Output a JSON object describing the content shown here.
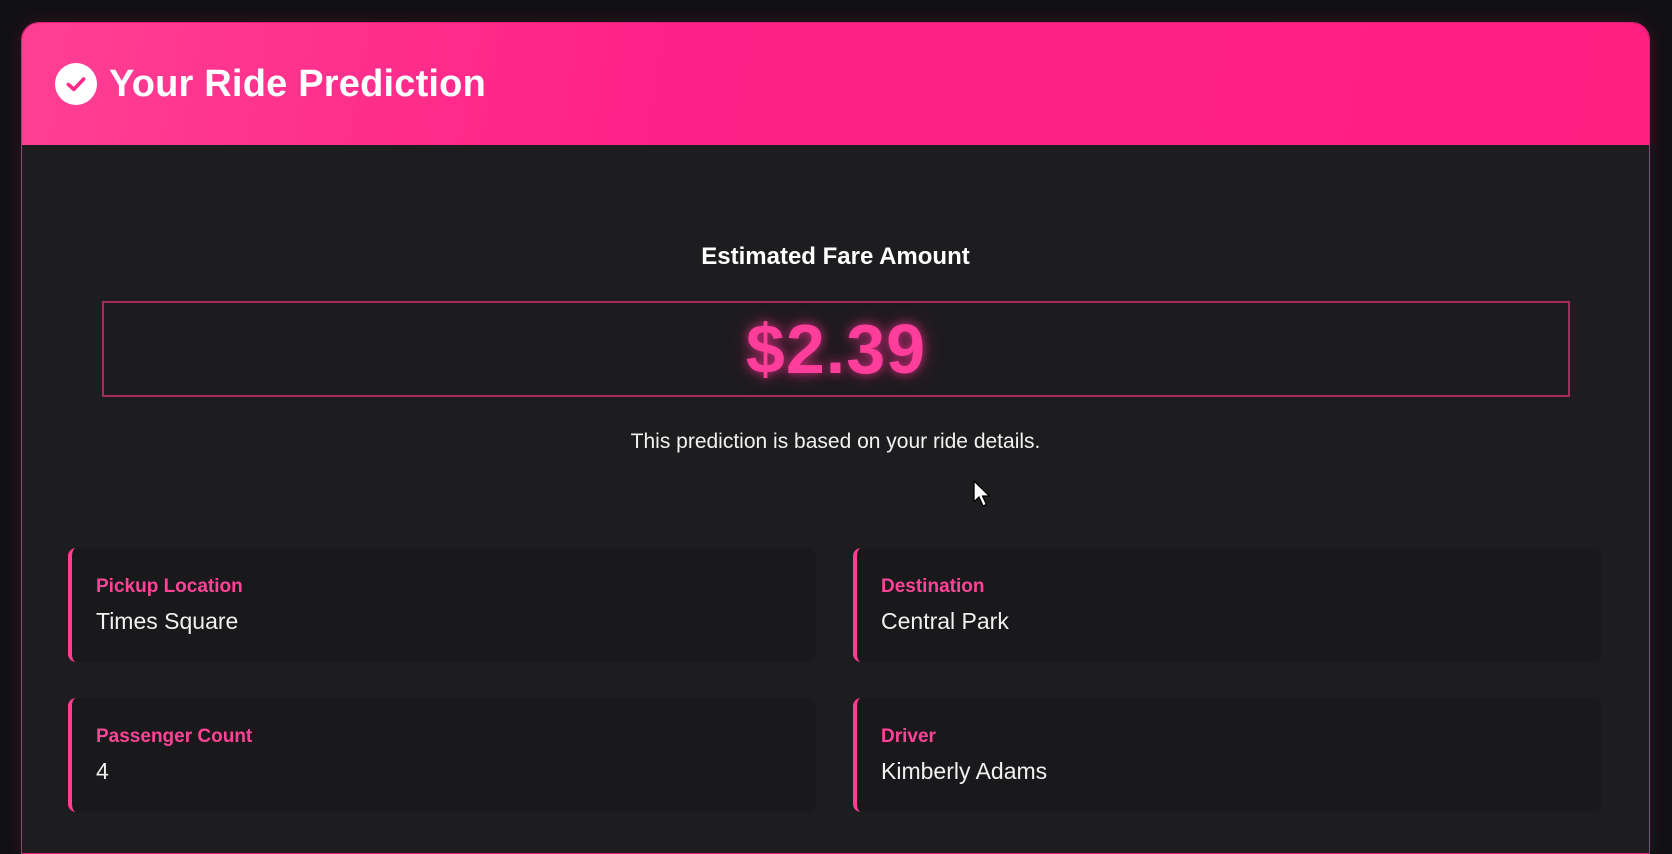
{
  "header": {
    "title": "Your Ride Prediction",
    "icon": "check-circle-icon"
  },
  "prediction": {
    "label": "Estimated Fare Amount",
    "amount": "$2.39",
    "note": "This prediction is based on your ride details."
  },
  "details": [
    {
      "label": "Pickup Location",
      "value": "Times Square"
    },
    {
      "label": "Destination",
      "value": "Central Park"
    },
    {
      "label": "Passenger Count",
      "value": "4"
    },
    {
      "label": "Driver",
      "value": "Kimberly Adams"
    }
  ],
  "colors": {
    "accent": "#ff2087",
    "fare_text": "#ff3d9a",
    "background": "#1d1c1e"
  }
}
